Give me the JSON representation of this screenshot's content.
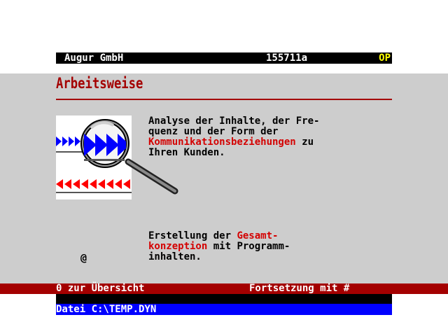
{
  "header": {
    "company": "Augur GmbH",
    "page_id": "155711a",
    "status": "OP"
  },
  "content": {
    "title": "Arbeitsweise",
    "paragraph1": {
      "line1": "Analyse der Inhalte, der Fre-",
      "line2": "quenz und der Form der",
      "line3_highlight": "Kommunikationsbeziehungen",
      "line3_rest": " zu",
      "line4": "Ihren Kunden."
    },
    "paragraph2": {
      "line1_text": "Erstellung der ",
      "line1_highlight": "Gesamt-",
      "line2_highlight": "konzeption",
      "line2_rest": " mit Programm-",
      "line3": "inhalten."
    },
    "symbol": "@"
  },
  "navigation": {
    "left": "0 zur Übersicht",
    "right": "Fortsetzung mit #"
  },
  "footer": {
    "file_label": "Datei C:\\TEMP.DYN"
  },
  "colors": {
    "title_red": "#a40000",
    "highlight_red": "#d40000",
    "panel_gray": "#cdcdcd",
    "status_yellow": "#ffff00",
    "file_bar_blue": "#0000ff",
    "arrow_blue": "#0000ff",
    "arrow_red": "#ff0000"
  }
}
